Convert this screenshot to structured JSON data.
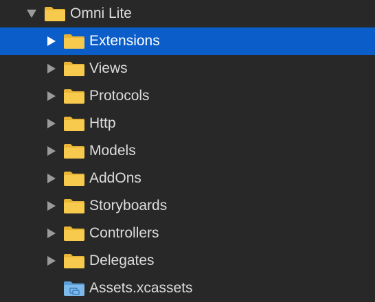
{
  "navigator": {
    "root": {
      "label": "Omni Lite",
      "icon": "folder-icon",
      "expanded": true
    },
    "items": [
      {
        "label": "Extensions",
        "icon": "folder-icon",
        "selected": true
      },
      {
        "label": "Views",
        "icon": "folder-icon"
      },
      {
        "label": "Protocols",
        "icon": "folder-icon"
      },
      {
        "label": "Http",
        "icon": "folder-icon"
      },
      {
        "label": "Models",
        "icon": "folder-icon"
      },
      {
        "label": "AddOns",
        "icon": "folder-icon"
      },
      {
        "label": "Storyboards",
        "icon": "folder-icon"
      },
      {
        "label": "Controllers",
        "icon": "folder-icon"
      },
      {
        "label": "Delegates",
        "icon": "folder-icon"
      },
      {
        "label": "Assets.xcassets",
        "icon": "asset-catalog-icon"
      }
    ]
  },
  "colors": {
    "background": "#282828",
    "selection": "#0b5dc9",
    "folder": "#f5c74a",
    "text": "#dcdcdc",
    "disclosure": "#9a9a9a"
  }
}
